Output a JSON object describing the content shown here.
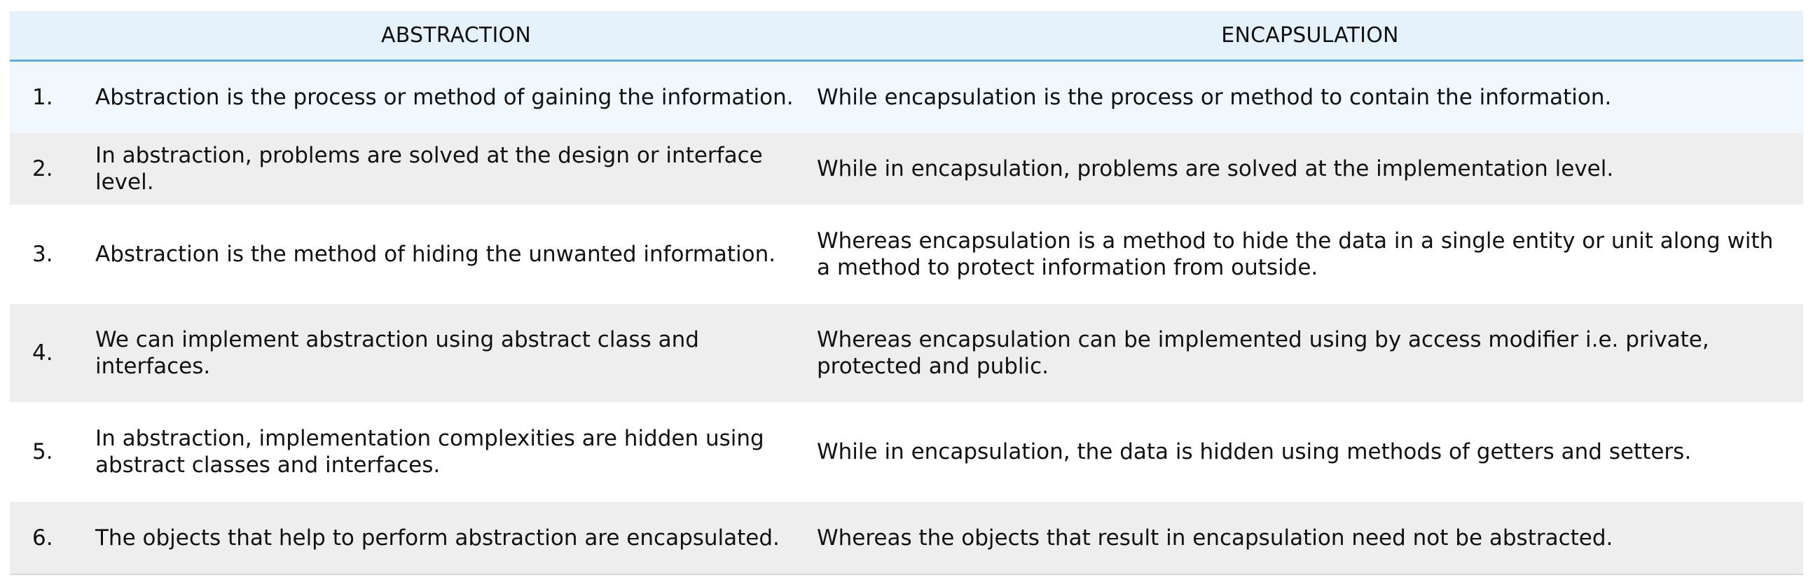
{
  "table": {
    "header": {
      "abstraction": "ABSTRACTION",
      "encapsulation": "ENCAPSULATION"
    },
    "rows": [
      {
        "num": "1.",
        "abstraction": "Abstraction is the process or method of gaining the information.",
        "encapsulation": "While encapsulation is the process or method to contain the information."
      },
      {
        "num": "2.",
        "abstraction": "In abstraction, problems are solved at the design or interface level.",
        "encapsulation": "While in encapsulation, problems are solved at the implementation level."
      },
      {
        "num": "3.",
        "abstraction": "Abstraction is the method of hiding the unwanted information.",
        "encapsulation": "Whereas encapsulation is a method to hide the data in a single entity or unit along with a method to protect information from outside."
      },
      {
        "num": "4.",
        "abstraction": "We can implement abstraction using abstract class and interfaces.",
        "encapsulation": "Whereas encapsulation can be implemented using by access modifier i.e. private, protected and public."
      },
      {
        "num": "5.",
        "abstraction": "In abstraction, implementation complexities are hidden using abstract classes and interfaces.",
        "encapsulation": "While in encapsulation, the data is hidden using methods of getters and setters."
      },
      {
        "num": "6.",
        "abstraction": "The objects that help to perform abstraction are encapsulated.",
        "encapsulation": "Whereas the objects that result in encapsulation need not be abstracted."
      }
    ]
  },
  "colors": {
    "header_bg": "#e6f2fb",
    "header_border": "#5aaee6",
    "row_alt_bg": "#eeeeee",
    "row_first_bg": "#f0f8fd"
  }
}
